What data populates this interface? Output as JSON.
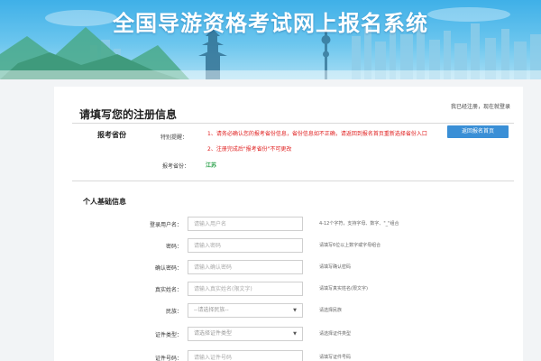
{
  "banner": {
    "title": "全国导游资格考试网上报名系统"
  },
  "page": {
    "section_title": "请填写您的注册信息",
    "login_hint": "我已经注册，现在就登录"
  },
  "province_section": {
    "label": "报考省份",
    "notice_label": "特别提醒：",
    "notice_1": "1、请务必确认您的报考省份信息，省份信息如不正确，请返回到报名首页重新选择省份入口",
    "notice_2": "2、注册完成后\"报考省份\"不可更改",
    "back_button": "返回报名首页",
    "province_label": "报考省份：",
    "province_value": "江苏"
  },
  "personal_section": {
    "label": "个人基础信息"
  },
  "form": {
    "fields": [
      {
        "label": "登录用户名：",
        "placeholder": "请输入用户名",
        "hint": "4-12个字符，支持字母、数字、\"_\"组合",
        "type": "text"
      },
      {
        "label": "密码：",
        "placeholder": "请输入密码",
        "hint": "请填写6位以上数字或字母组合",
        "type": "password"
      },
      {
        "label": "确认密码：",
        "placeholder": "请输入确认密码",
        "hint": "请填写确认密码",
        "type": "password"
      },
      {
        "label": "真实姓名：",
        "placeholder": "请输入真实姓名(限文字)",
        "hint": "请填写真实姓名(限文字)",
        "type": "text"
      },
      {
        "label": "民族：",
        "value": "--请选择民族--",
        "hint": "请选择民族",
        "type": "select"
      },
      {
        "label": "证件类型：",
        "value": "请选择证件类型",
        "hint": "请选择证件类型",
        "type": "select"
      },
      {
        "label": "证件号码：",
        "placeholder": "请输入证件号码",
        "hint": "请填写证件号码",
        "type": "text"
      }
    ]
  },
  "colors": {
    "accent": "#3a8fd6",
    "warning": "#e02020",
    "province": "#2aa14a"
  }
}
